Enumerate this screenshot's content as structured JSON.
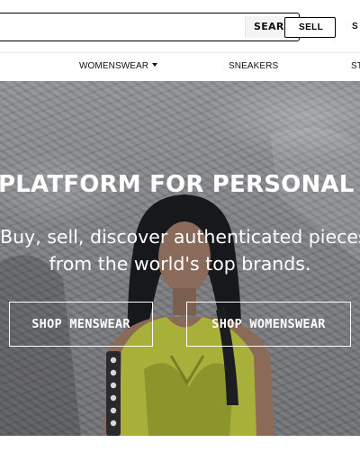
{
  "header": {
    "search_button": "SEARCH",
    "sell_button": "SELL",
    "signup_partial": "S"
  },
  "nav": {
    "items": [
      {
        "label": "WOMENSWEAR",
        "has_dropdown": true
      },
      {
        "label": "SNEAKERS",
        "has_dropdown": false
      },
      {
        "label": "ST",
        "has_dropdown": false
      }
    ]
  },
  "hero": {
    "headline": "PLATFORM FOR PERSONAL ST",
    "subline1": "Buy, sell, discover authenticated pieces",
    "subline2": "from the world's top brands.",
    "cta_mens": "SHOP MENSWEAR",
    "cta_womens": "SHOP WOMENSWEAR"
  },
  "colors": {
    "border": "#000000",
    "cta_border": "#ffffff",
    "hero_text": "#ffffff"
  }
}
